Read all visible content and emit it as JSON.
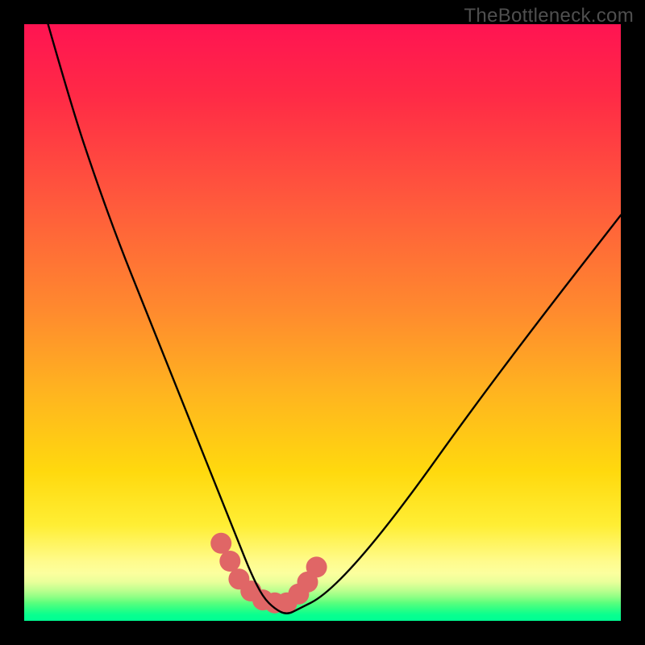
{
  "watermark": "TheBottleneck.com",
  "chart_data": {
    "type": "line",
    "title": "",
    "xlabel": "",
    "ylabel": "",
    "xlim": [
      0,
      100
    ],
    "ylim": [
      0,
      100
    ],
    "series": [
      {
        "name": "curve",
        "x": [
          4,
          8,
          12,
          16,
          20,
          24,
          28,
          32,
          34,
          36,
          38,
          40,
          42,
          44,
          46,
          50,
          56,
          64,
          74,
          86,
          100
        ],
        "values": [
          100,
          86,
          74,
          63,
          53,
          43,
          33,
          23,
          18,
          13,
          8,
          4,
          2,
          1,
          2,
          4,
          10,
          20,
          34,
          50,
          68
        ]
      }
    ],
    "markers": {
      "name": "dots",
      "x": [
        33,
        34.5,
        36,
        38,
        40,
        42,
        44,
        46,
        47.5,
        49
      ],
      "values": [
        13,
        10,
        7,
        5,
        3.5,
        3,
        3,
        4.5,
        6.5,
        9
      ],
      "color": "#e06666",
      "radius": 13
    },
    "colors": {
      "line": "#000000",
      "background_top": "#ff1452",
      "background_bottom": "#00ff93"
    },
    "grid": false,
    "legend": false
  }
}
